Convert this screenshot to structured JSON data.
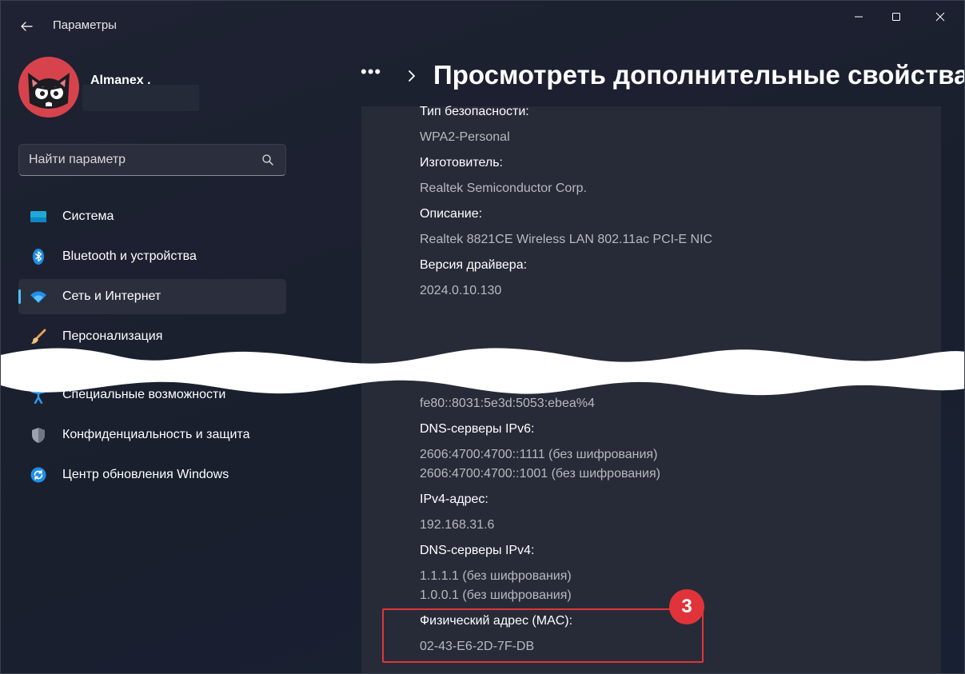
{
  "titlebar": {
    "app_title": "Параметры"
  },
  "profile": {
    "user_name": "Almanex ."
  },
  "search": {
    "placeholder": "Найти параметр"
  },
  "sidebar": {
    "items": [
      {
        "label": "Система",
        "icon": "monitor-icon"
      },
      {
        "label": "Bluetooth и устройства",
        "icon": "bluetooth-icon"
      },
      {
        "label": "Сеть и Интернет",
        "icon": "wifi-icon",
        "active": true
      },
      {
        "label": "Персонализация",
        "icon": "brush-icon"
      },
      {
        "label": "Специальные возможности",
        "icon": "accessibility-icon"
      },
      {
        "label": "Конфиденциальность и защита",
        "icon": "shield-icon"
      },
      {
        "label": "Центр обновления Windows",
        "icon": "update-icon"
      }
    ]
  },
  "header": {
    "more_label": "•••",
    "title": "Просмотреть дополнительные свойства"
  },
  "properties": {
    "security_type_label": "Тип безопасности:",
    "security_type_value": "WPA2-Personal",
    "manufacturer_label": "Изготовитель:",
    "manufacturer_value": "Realtek Semiconductor Corp.",
    "description_label": "Описание:",
    "description_value": "Realtek 8821CE Wireless LAN 802.11ac PCI-E NIC",
    "driver_label": "Версия драйвера:",
    "driver_value": "2024.0.10.130",
    "ipv6_local_value": "fe80::8031:5e3d:5053:ebea%4",
    "dns_ipv6_label": "DNS-серверы IPv6:",
    "dns_ipv6_value_1": "2606:4700:4700::1111 (без шифрования)",
    "dns_ipv6_value_2": "2606:4700:4700::1001 (без шифрования)",
    "ipv4_label": "IPv4-адрес:",
    "ipv4_value": "192.168.31.6",
    "dns_ipv4_label": "DNS-серверы IPv4:",
    "dns_ipv4_value_1": "1.1.1.1 (без шифрования)",
    "dns_ipv4_value_2": "1.0.0.1 (без шифрования)",
    "mac_label": "Физический адрес (MAC):",
    "mac_value": "02-43-E6-2D-7F-DB"
  },
  "annotation": {
    "step_number": "3"
  },
  "colors": {
    "accent": "#4cc2ff",
    "highlight": "#e0343a",
    "avatar_bg": "#d6434d",
    "panel": "#272b38"
  }
}
